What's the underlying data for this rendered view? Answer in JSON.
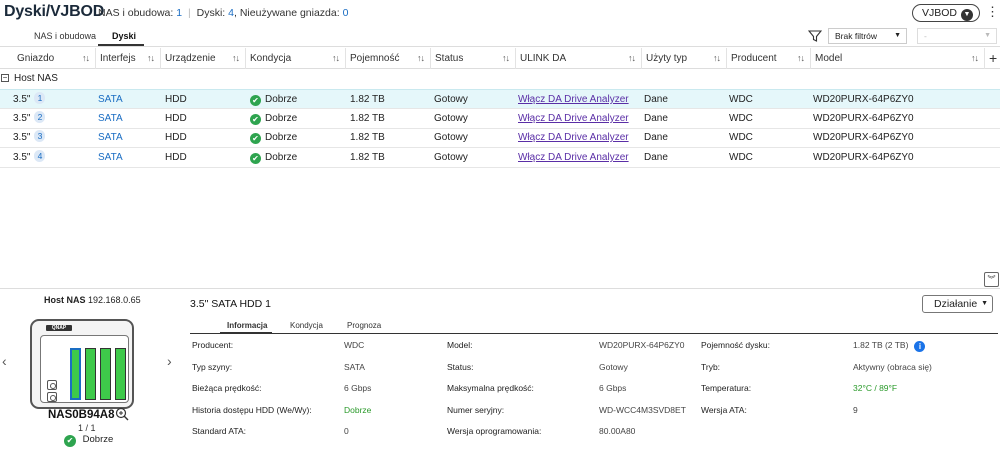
{
  "header": {
    "title": "Dyski/VJBOD",
    "summary_nas_label": "NAS i obudowa:",
    "summary_nas_count": "1",
    "summary_disks_label": "Dyski:",
    "summary_disks_count": "4",
    "summary_unused_label": "Nieużywane gniazda:",
    "summary_unused_count": "0",
    "vjbod_button": "VJBOD"
  },
  "tabs": [
    {
      "label": "NAS i obudowa",
      "active": false
    },
    {
      "label": "Dyski",
      "active": true
    }
  ],
  "filter": {
    "selected": "Brak filtrów",
    "secondary": "-"
  },
  "table": {
    "columns": [
      "Gniazdo",
      "Interfejs",
      "Urządzenie",
      "Kondycja",
      "Pojemność",
      "Status",
      "ULINK DA",
      "Użyty typ",
      "Producent",
      "Model"
    ],
    "group_label": "Host NAS",
    "rows": [
      {
        "slot": "3.5\"",
        "slot_num": "1",
        "interface": "SATA",
        "device": "HDD",
        "health": "Dobrze",
        "capacity": "1.82 TB",
        "status": "Gotowy",
        "ulink": "Włącz DA Drive Analyzer",
        "used_type": "Dane",
        "vendor": "WDC",
        "model": "WD20PURX-64P6ZY0"
      },
      {
        "slot": "3.5\"",
        "slot_num": "2",
        "interface": "SATA",
        "device": "HDD",
        "health": "Dobrze",
        "capacity": "1.82 TB",
        "status": "Gotowy",
        "ulink": "Włącz DA Drive Analyzer",
        "used_type": "Dane",
        "vendor": "WDC",
        "model": "WD20PURX-64P6ZY0"
      },
      {
        "slot": "3.5\"",
        "slot_num": "3",
        "interface": "SATA",
        "device": "HDD",
        "health": "Dobrze",
        "capacity": "1.82 TB",
        "status": "Gotowy",
        "ulink": "Włącz DA Drive Analyzer",
        "used_type": "Dane",
        "vendor": "WDC",
        "model": "WD20PURX-64P6ZY0"
      },
      {
        "slot": "3.5\"",
        "slot_num": "4",
        "interface": "SATA",
        "device": "HDD",
        "health": "Dobrze",
        "capacity": "1.82 TB",
        "status": "Gotowy",
        "ulink": "Włącz DA Drive Analyzer",
        "used_type": "Dane",
        "vendor": "WDC",
        "model": "WD20PURX-64P6ZY0"
      }
    ]
  },
  "nas_panel": {
    "title_label": "Host NAS",
    "ip": "192.168.0.65",
    "logo": "QNAP",
    "name": "NAS0B94A8",
    "pages": "1 / 1",
    "status": "Dobrze"
  },
  "disk_panel": {
    "title": "3.5\" SATA HDD 1",
    "action_button": "Działanie",
    "tabs": [
      "Informacja",
      "Kondycja",
      "Prognoza"
    ],
    "info": {
      "producer_label": "Producent:",
      "producer": "WDC",
      "bus_label": "Typ szyny:",
      "bus": "SATA",
      "speed_label": "Bieżąca prędkość:",
      "speed": "6 Gbps",
      "history_label": "Historia dostępu HDD (We/Wy):",
      "history": "Dobrze",
      "ata_std_label": "Standard ATA:",
      "ata_std": "0",
      "model_label": "Model:",
      "model": "WD20PURX-64P6ZY0",
      "status_label": "Status:",
      "status": "Gotowy",
      "max_speed_label": "Maksymalna prędkość:",
      "max_speed": "6 Gbps",
      "serial_label": "Numer seryjny:",
      "serial": "WD-WCC4M3SVD8ET",
      "firmware_label": "Wersja oprogramowania:",
      "firmware": "80.00A80",
      "capacity_label": "Pojemność dysku:",
      "capacity": "1.82 TB (2 TB)",
      "mode_label": "Tryb:",
      "mode": "Aktywny (obraca się)",
      "temp_label": "Temperatura:",
      "temp": "32°C / 89°F",
      "ata_ver_label": "Wersja ATA:",
      "ata_ver": "9"
    }
  }
}
